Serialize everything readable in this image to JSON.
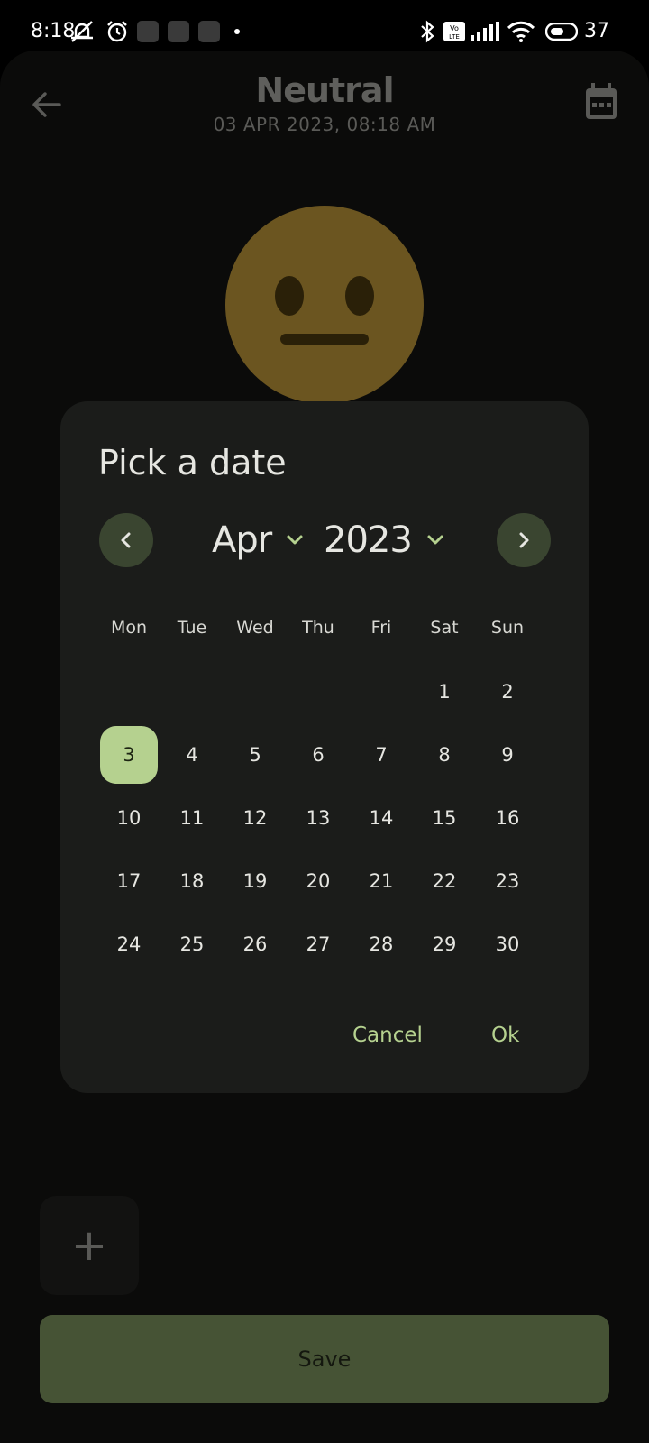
{
  "status_bar": {
    "time": "8:18",
    "battery": "37",
    "icons": [
      "muted-bell-icon",
      "alarm-icon",
      "app-icon",
      "app-icon",
      "app-icon",
      "dot-icon",
      "bluetooth-icon",
      "volte-icon",
      "signal-icon",
      "wifi-icon",
      "battery-icon"
    ]
  },
  "header": {
    "title": "Neutral",
    "datetime": "03 APR 2023, 08:18 AM",
    "back_icon": "arrow-left-icon",
    "calendar_icon": "calendar-icon"
  },
  "mood": {
    "icon": "neutral-face-icon",
    "color": "#6b5520"
  },
  "dialog": {
    "title": "Pick a date",
    "month": "Apr",
    "year": "2023",
    "weekdays": [
      "Mon",
      "Tue",
      "Wed",
      "Thu",
      "Fri",
      "Sat",
      "Sun"
    ],
    "first_weekday_index": 5,
    "days": [
      "1",
      "2",
      "3",
      "4",
      "5",
      "6",
      "7",
      "8",
      "9",
      "10",
      "11",
      "12",
      "13",
      "14",
      "15",
      "16",
      "17",
      "18",
      "19",
      "20",
      "21",
      "22",
      "23",
      "24",
      "25",
      "26",
      "27",
      "28",
      "29",
      "30"
    ],
    "selected_day": "3",
    "cancel_label": "Cancel",
    "ok_label": "Ok",
    "accent_color": "#b5d18f"
  },
  "bottom": {
    "add_label": "+",
    "save_label": "Save"
  }
}
